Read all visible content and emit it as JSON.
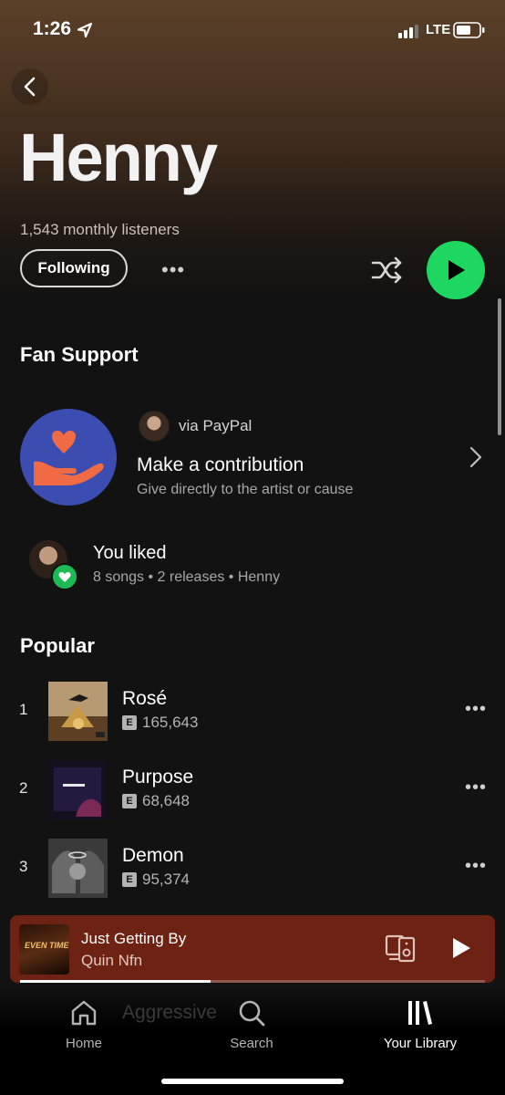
{
  "status_bar": {
    "time": "1:26",
    "network": "LTE"
  },
  "artist": {
    "name": "Henny",
    "monthly_listeners": "1,543 monthly listeners",
    "follow_label": "Following",
    "more_label": "•••"
  },
  "fan_support": {
    "title": "Fan Support",
    "via": "via PayPal",
    "contribution_title": "Make a contribution",
    "contribution_subtitle": "Give directly to the artist or cause"
  },
  "liked": {
    "title": "You liked",
    "subtitle": "8 songs • 2 releases • Henny"
  },
  "popular": {
    "title": "Popular",
    "tracks": [
      {
        "rank": "1",
        "title": "Rosé",
        "explicit": "E",
        "plays": "165,643"
      },
      {
        "rank": "2",
        "title": "Purpose",
        "explicit": "E",
        "plays": "68,648"
      },
      {
        "rank": "3",
        "title": "Demon",
        "explicit": "E",
        "plays": "95,374"
      }
    ],
    "partially_hidden_track": "Aggressive"
  },
  "now_playing": {
    "title": "Just Getting By",
    "artist": "Quin Nfn",
    "progress_fraction": 0.41,
    "accent_color": "#6d2213"
  },
  "nav": {
    "home": "Home",
    "search": "Search",
    "library": "Your Library"
  },
  "colors": {
    "accent_green": "#1ed760",
    "background": "#121212"
  }
}
